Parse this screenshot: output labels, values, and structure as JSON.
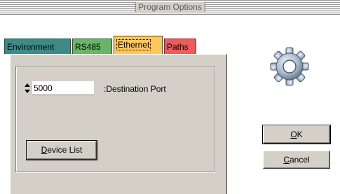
{
  "window": {
    "title": "Program Options"
  },
  "tabs": [
    {
      "label": "Environment",
      "color": "#3c8b88",
      "selected": false
    },
    {
      "label": "RS485",
      "color": "#67b567",
      "selected": false
    },
    {
      "label": "Ethernet",
      "color": "#ffc75a",
      "selected": true
    },
    {
      "label": "Paths",
      "color": "#f05a5a",
      "selected": false
    }
  ],
  "ethernet": {
    "destination_port": {
      "value": "5000",
      "label": ":Destination Port"
    },
    "device_list_button": {
      "mnemonic": "D",
      "rest": "evice List"
    }
  },
  "buttons": {
    "ok": {
      "mnemonic": "O",
      "rest": "K"
    },
    "cancel": {
      "mnemonic": "C",
      "rest": "ancel"
    }
  },
  "icons": {
    "gear": "gear-icon",
    "spinner_up": "arrow-up-icon",
    "spinner_down": "arrow-down-icon"
  },
  "colors": {
    "panel_bg": "#d4d0c8",
    "gear_body": "#a9b8cc"
  }
}
